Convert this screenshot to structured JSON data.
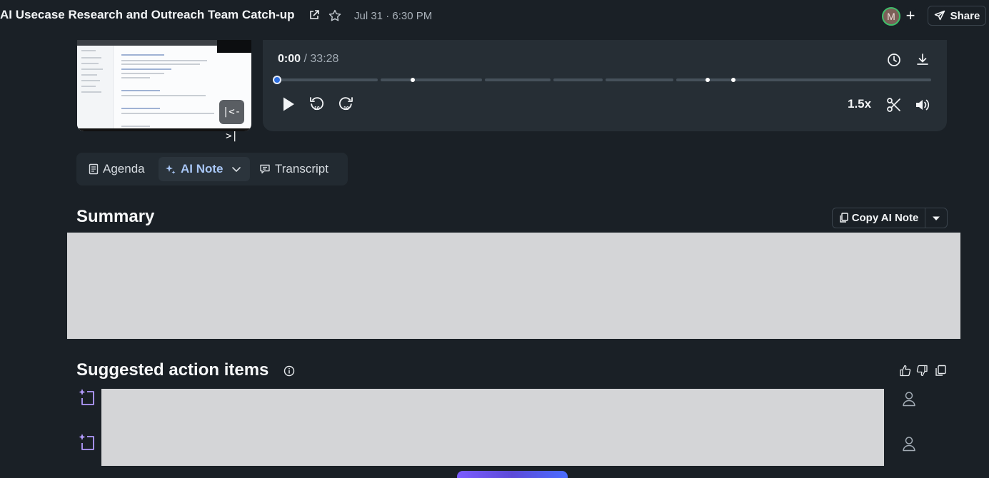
{
  "header": {
    "title": "AI Usecase Research and Outreach Team Catch-up",
    "date": "Jul 31 · 6:30 PM",
    "avatar_initial": "M",
    "add_label": "+",
    "share_label": "Share"
  },
  "video": {
    "expand_label": "|<->|"
  },
  "player": {
    "current_time": "0:00",
    "separator": "/",
    "total_time": "33:28",
    "speed": "1.5x",
    "progress": 0
  },
  "tabs": [
    {
      "label": "Agenda",
      "icon": "document-icon",
      "active": false
    },
    {
      "label": "AI Note",
      "icon": "sparkle-icon",
      "active": true
    },
    {
      "label": "Transcript",
      "icon": "chat-icon",
      "active": false
    }
  ],
  "summary": {
    "title": "Summary",
    "copy_label": "Copy AI Note"
  },
  "action_items": {
    "title": "Suggested action items",
    "count_visible": 2
  },
  "colors": {
    "background": "#1a2026",
    "panel": "#262e35",
    "accent_blue": "#2f6fe0",
    "active_tab_text": "#a8c6f5",
    "sparkle_purple": "#b49cff",
    "redaction": "#d4d5d7"
  }
}
